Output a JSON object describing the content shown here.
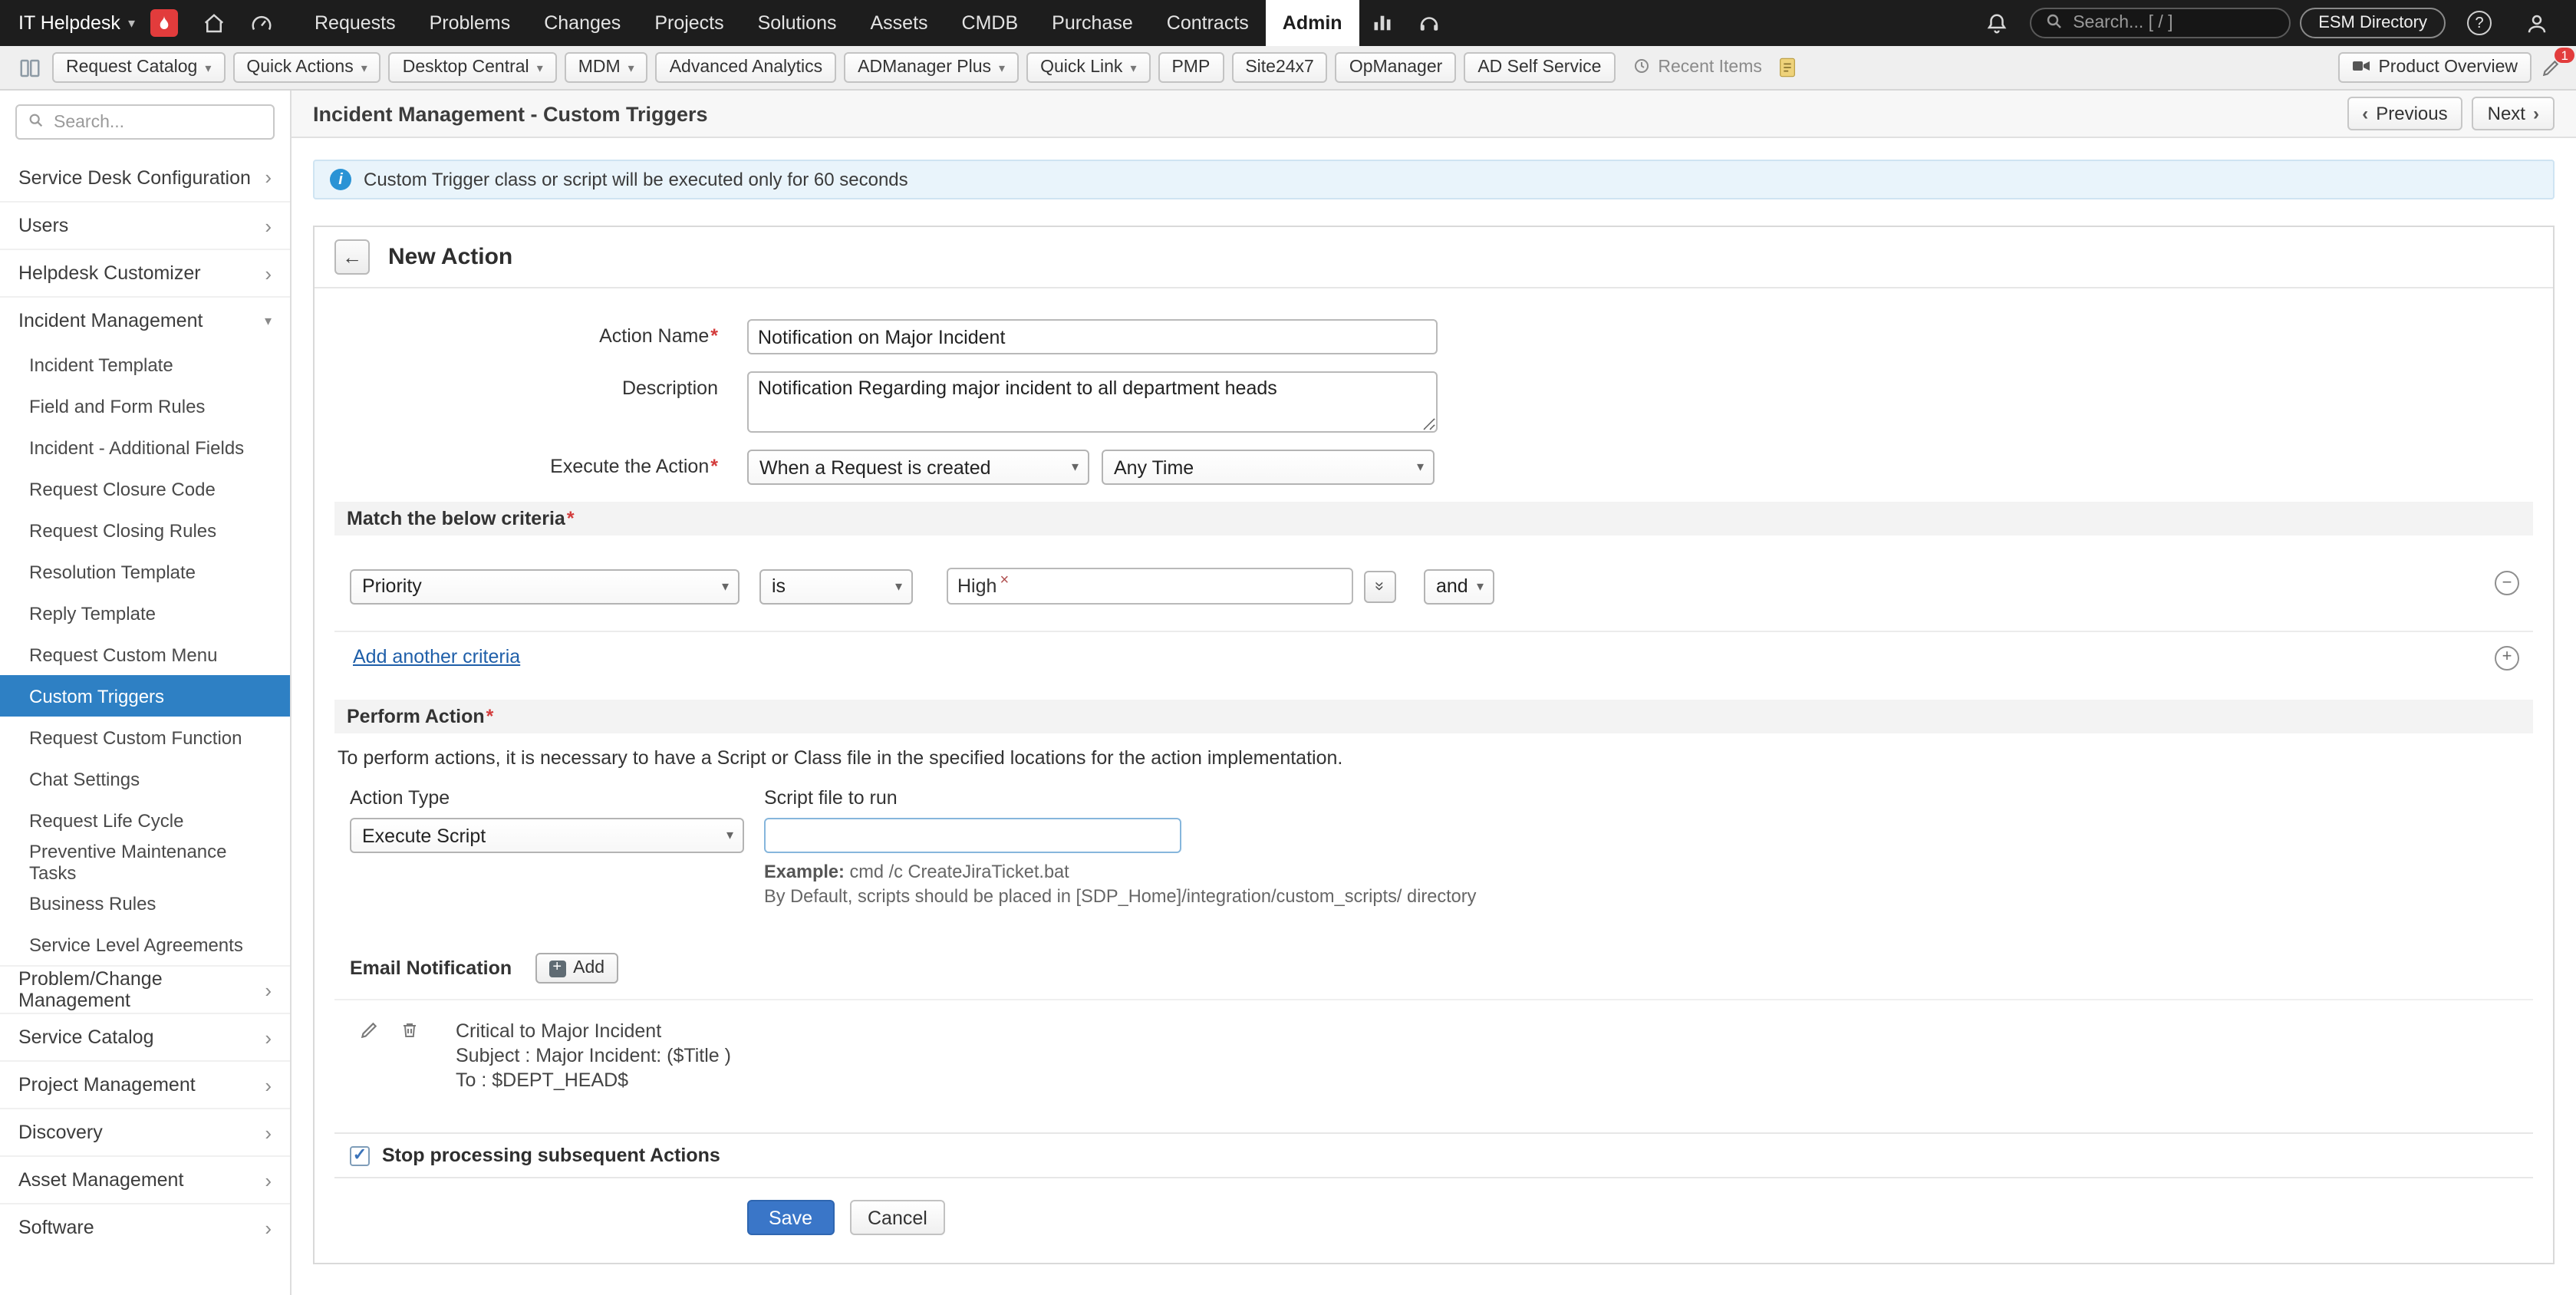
{
  "topnav": {
    "app_title": "IT Helpdesk",
    "menu": [
      "Requests",
      "Problems",
      "Changes",
      "Projects",
      "Solutions",
      "Assets",
      "CMDB",
      "Purchase",
      "Contracts",
      "Admin"
    ],
    "search_placeholder": "Search... [ / ]",
    "esm_directory_label": "ESM Directory"
  },
  "toolbar": {
    "buttons": [
      "Request Catalog",
      "Quick Actions",
      "Desktop Central",
      "MDM",
      "Advanced Analytics",
      "ADManager Plus",
      "Quick Link",
      "PMP",
      "Site24x7",
      "OpManager",
      "AD Self Service"
    ],
    "recent_items_label": "Recent Items",
    "product_overview_label": "Product Overview",
    "edit_badge": "1"
  },
  "sidebar": {
    "search_placeholder": "Search...",
    "groups_before": [
      "Service Desk Configuration",
      "Users",
      "Helpdesk Customizer"
    ],
    "expanded_group": "Incident Management",
    "children": [
      "Incident Template",
      "Field and Form Rules",
      "Incident - Additional Fields",
      "Request Closure Code",
      "Request Closing Rules",
      "Resolution Template",
      "Reply Template",
      "Request Custom Menu",
      "Custom Triggers",
      "Request Custom Function",
      "Chat Settings",
      "Request Life Cycle",
      "Preventive Maintenance Tasks",
      "Business Rules",
      "Service Level Agreements"
    ],
    "selected_child": "Custom Triggers",
    "groups_after": [
      "Problem/Change Management",
      "Service Catalog",
      "Project Management",
      "Discovery",
      "Asset Management",
      "Software"
    ]
  },
  "page": {
    "title": "Incident Management - Custom Triggers",
    "previous_label": "Previous",
    "next_label": "Next",
    "info_banner": "Custom Trigger class or script will be executed only for 60 seconds"
  },
  "form": {
    "panel_title": "New Action",
    "required_marker": "*",
    "action_name": {
      "label": "Action Name",
      "value": "Notification on Major Incident"
    },
    "description": {
      "label": "Description",
      "value": "Notification Regarding major incident to all department heads"
    },
    "execute_action": {
      "label": "Execute the Action",
      "when_value": "When a Request is created",
      "time_value": "Any Time"
    },
    "criteria": {
      "header": "Match the below criteria",
      "field": "Priority",
      "operator": "is",
      "value_chip": "High",
      "join": "and",
      "add_link": "Add another criteria"
    },
    "perform": {
      "header": "Perform Action",
      "note": "To perform actions, it is necessary to have a Script or Class file in the specified locations for the action implementation.",
      "action_type_label": "Action Type",
      "action_type_value": "Execute Script",
      "script_label": "Script file to run",
      "example_bold": "Example:",
      "example_text": "cmd /c CreateJiraTicket.bat",
      "default_note": "By Default, scripts should be placed in [SDP_Home]/integration/custom_scripts/ directory"
    },
    "email_notification": {
      "label": "Email Notification",
      "add_label": "Add",
      "item_title": "Critical to Major Incident",
      "item_subject": "Subject : Major Incident: ($Title )",
      "item_to": "To : $DEPT_HEAD$"
    },
    "stop_label": "Stop processing subsequent Actions",
    "save_label": "Save",
    "cancel_label": "Cancel"
  }
}
